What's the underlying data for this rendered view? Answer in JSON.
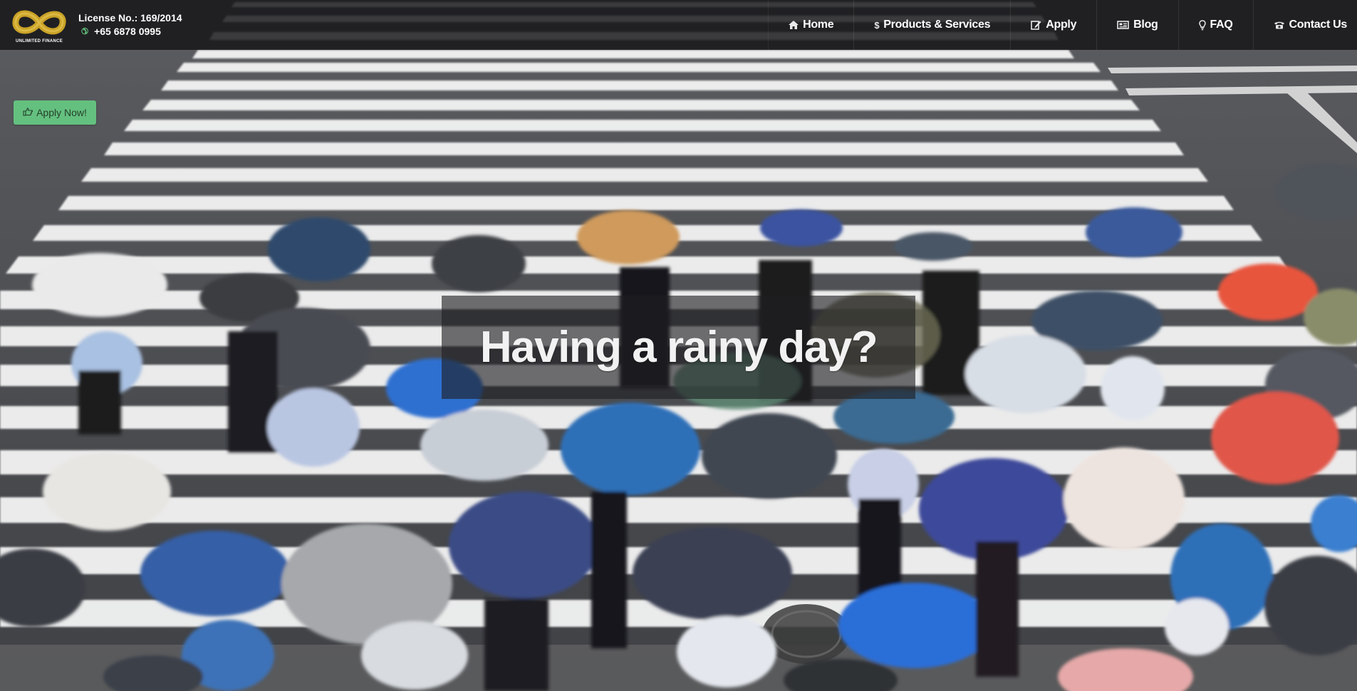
{
  "brand": {
    "logo_text": "UNLIMITED FINANCE",
    "license": "License No.: 169/2014",
    "phone": "+65 6878 0995",
    "logo_color": "#c9a227",
    "phone_icon_color": "#63c07a"
  },
  "nav": {
    "items": [
      {
        "label": "Home",
        "icon": "home-icon"
      },
      {
        "label": "Products & Services",
        "icon": "dollar-icon"
      },
      {
        "label": "Apply",
        "icon": "edit-icon"
      },
      {
        "label": "Blog",
        "icon": "newspaper-icon"
      },
      {
        "label": "FAQ",
        "icon": "lightbulb-icon"
      },
      {
        "label": "Contact Us",
        "icon": "phone-icon"
      }
    ]
  },
  "cta": {
    "label": "Apply Now!",
    "icon": "hand-point-right-icon",
    "color": "#64c07f"
  },
  "hero": {
    "headline": "Having a rainy day?",
    "background": "photo of a crowd with umbrellas crossing a zebra crosswalk in the rain"
  }
}
